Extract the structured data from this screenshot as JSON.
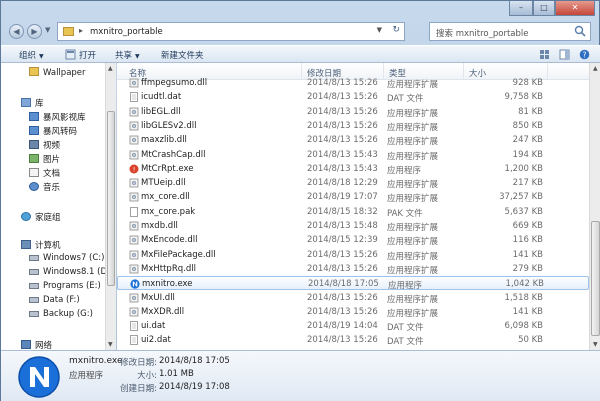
{
  "window": {
    "controls": {
      "minimize": "–",
      "maximize": "□",
      "close": "✕"
    }
  },
  "address": {
    "path": "mxnitro_portable",
    "search_placeholder": "搜索 mxnitro_portable"
  },
  "toolbar": {
    "organize": "组织",
    "open": "打开",
    "share": "共享",
    "new_folder": "新建文件夹"
  },
  "sidebar": {
    "items": [
      {
        "label": "Wallpaper",
        "icon": "folder-icon"
      },
      {
        "label": "库",
        "icon": "library-icon"
      },
      {
        "label": "暴风影视库",
        "icon": "video-library-icon"
      },
      {
        "label": "暴风转码",
        "icon": "video-library-icon"
      },
      {
        "label": "视频",
        "icon": "video-icon"
      },
      {
        "label": "图片",
        "icon": "picture-icon"
      },
      {
        "label": "文档",
        "icon": "document-icon"
      },
      {
        "label": "音乐",
        "icon": "music-icon"
      },
      {
        "label": "家庭组",
        "icon": "homegroup-icon"
      },
      {
        "label": "计算机",
        "icon": "computer-icon"
      },
      {
        "label": "Windows7 (C:)",
        "icon": "drive-icon"
      },
      {
        "label": "Windows8.1 (D:)",
        "icon": "drive-icon"
      },
      {
        "label": "Programs (E:)",
        "icon": "drive-icon"
      },
      {
        "label": "Data (F:)",
        "icon": "drive-icon"
      },
      {
        "label": "Backup (G:)",
        "icon": "drive-icon"
      },
      {
        "label": "网络",
        "icon": "network-icon"
      }
    ]
  },
  "columns": {
    "name": "名称",
    "date": "修改日期",
    "type": "类型",
    "size": "大小"
  },
  "files": [
    {
      "name": "ffmpegsumo.dll",
      "date": "2014/8/13 15:26",
      "type": "应用程序扩展",
      "size": "928 KB",
      "icon": "dll-icon"
    },
    {
      "name": "icudtl.dat",
      "date": "2014/8/13 15:26",
      "type": "DAT 文件",
      "size": "9,758 KB",
      "icon": "dat-icon"
    },
    {
      "name": "libEGL.dll",
      "date": "2014/8/13 15:26",
      "type": "应用程序扩展",
      "size": "81 KB",
      "icon": "dll-icon"
    },
    {
      "name": "libGLESv2.dll",
      "date": "2014/8/13 15:26",
      "type": "应用程序扩展",
      "size": "850 KB",
      "icon": "dll-icon"
    },
    {
      "name": "maxzlib.dll",
      "date": "2014/8/13 15:26",
      "type": "应用程序扩展",
      "size": "247 KB",
      "icon": "dll-icon"
    },
    {
      "name": "MtCrashCap.dll",
      "date": "2014/8/13 15:43",
      "type": "应用程序扩展",
      "size": "194 KB",
      "icon": "dll-icon"
    },
    {
      "name": "MtCrRpt.exe",
      "date": "2014/8/13 15:43",
      "type": "应用程序",
      "size": "1,200 KB",
      "icon": "crash-report-icon"
    },
    {
      "name": "MTUeip.dll",
      "date": "2014/8/18 12:29",
      "type": "应用程序扩展",
      "size": "217 KB",
      "icon": "dll-icon"
    },
    {
      "name": "mx_core.dll",
      "date": "2014/8/19 17:07",
      "type": "应用程序扩展",
      "size": "37,257 KB",
      "icon": "dll-icon"
    },
    {
      "name": "mx_core.pak",
      "date": "2014/8/15 18:32",
      "type": "PAK 文件",
      "size": "5,637 KB",
      "icon": "pak-icon"
    },
    {
      "name": "mxdb.dll",
      "date": "2014/8/13 15:48",
      "type": "应用程序扩展",
      "size": "669 KB",
      "icon": "dll-icon"
    },
    {
      "name": "MxEncode.dll",
      "date": "2014/8/15 12:39",
      "type": "应用程序扩展",
      "size": "116 KB",
      "icon": "dll-icon"
    },
    {
      "name": "MxFilePackage.dll",
      "date": "2014/8/13 15:26",
      "type": "应用程序扩展",
      "size": "141 KB",
      "icon": "dll-icon"
    },
    {
      "name": "MxHttpRq.dll",
      "date": "2014/8/13 15:26",
      "type": "应用程序扩展",
      "size": "279 KB",
      "icon": "dll-icon"
    },
    {
      "name": "mxnitro.exe",
      "date": "2014/8/18 17:05",
      "type": "应用程序",
      "size": "1,042 KB",
      "icon": "mxnitro-app-icon",
      "selected": true
    },
    {
      "name": "MxUI.dll",
      "date": "2014/8/13 15:26",
      "type": "应用程序扩展",
      "size": "1,518 KB",
      "icon": "dll-icon"
    },
    {
      "name": "MxXDR.dll",
      "date": "2014/8/13 15:26",
      "type": "应用程序扩展",
      "size": "141 KB",
      "icon": "dll-icon"
    },
    {
      "name": "ui.dat",
      "date": "2014/8/19 14:04",
      "type": "DAT 文件",
      "size": "6,098 KB",
      "icon": "dat-icon"
    },
    {
      "name": "ui2.dat",
      "date": "2014/8/13 15:26",
      "type": "DAT 文件",
      "size": "50 KB",
      "icon": "dat-icon"
    }
  ],
  "details": {
    "name": "mxnitro.exe",
    "type": "应用程序",
    "modified_label": "修改日期:",
    "modified": "2014/8/18 17:05",
    "size_label": "大小:",
    "size": "1.01 MB",
    "created_label": "创建日期:",
    "created": "2014/8/19 17:08"
  },
  "colors": {
    "app_icon": "#1b6fd8",
    "selection_border": "#9fc3ea",
    "crash_icon": "#d9412b"
  }
}
